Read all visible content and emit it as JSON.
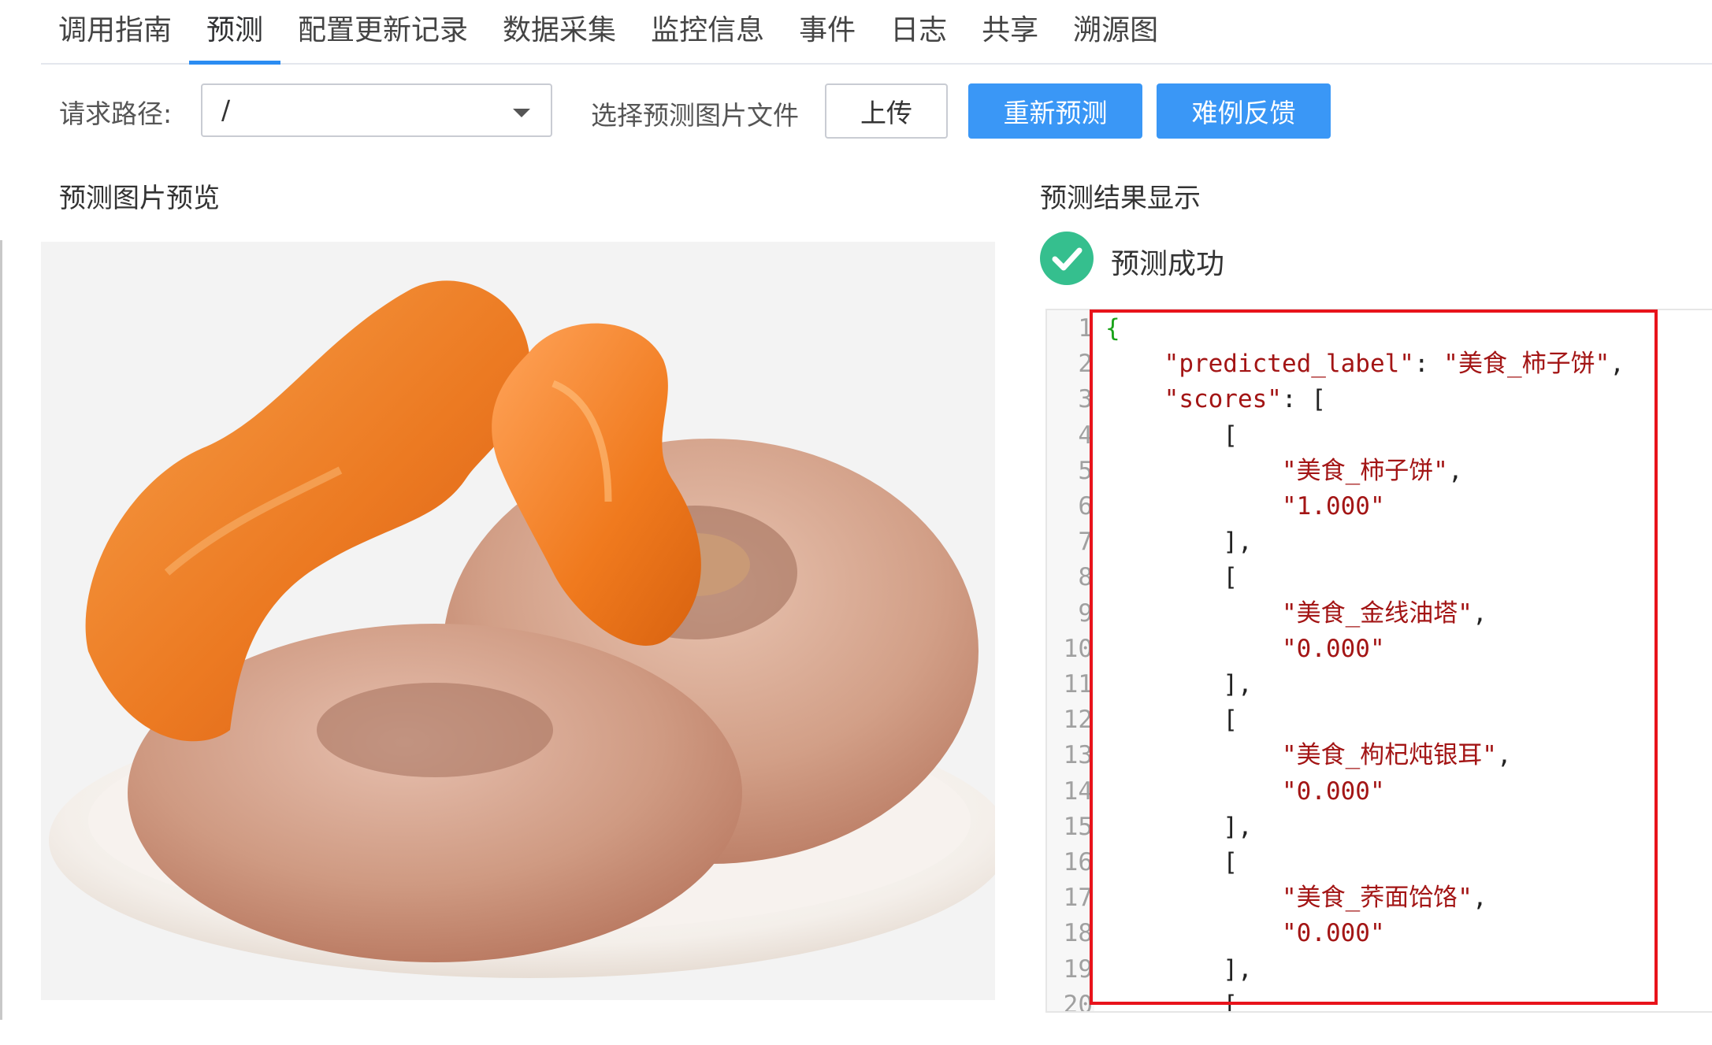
{
  "tabs": [
    {
      "label": "调用指南",
      "active": false
    },
    {
      "label": "预测",
      "active": true
    },
    {
      "label": "配置更新记录",
      "active": false
    },
    {
      "label": "数据采集",
      "active": false
    },
    {
      "label": "监控信息",
      "active": false
    },
    {
      "label": "事件",
      "active": false
    },
    {
      "label": "日志",
      "active": false
    },
    {
      "label": "共享",
      "active": false
    },
    {
      "label": "溯源图",
      "active": false
    }
  ],
  "toolbar": {
    "path_label": "请求路径:",
    "path_value": "/",
    "file_label": "选择预测图片文件",
    "upload_label": "上传",
    "repredict_label": "重新预测",
    "feedback_label": "难例反馈"
  },
  "preview": {
    "heading": "预测图片预览",
    "image_subject": "dried persimmons (柿子饼) on a white plate"
  },
  "result": {
    "heading": "预测结果显示",
    "status_text": "预测成功",
    "status_color": "#35bf8e"
  },
  "code_lines": [
    {
      "n": "1",
      "text": "{"
    },
    {
      "n": "2",
      "text": "    \"predicted_label\": \"美食_柿子饼\","
    },
    {
      "n": "3",
      "text": "    \"scores\": ["
    },
    {
      "n": "4",
      "text": "        ["
    },
    {
      "n": "5",
      "text": "            \"美食_柿子饼\","
    },
    {
      "n": "6",
      "text": "            \"1.000\""
    },
    {
      "n": "7",
      "text": "        ],"
    },
    {
      "n": "8",
      "text": "        ["
    },
    {
      "n": "9",
      "text": "            \"美食_金线油塔\","
    },
    {
      "n": "10",
      "text": "            \"0.000\""
    },
    {
      "n": "11",
      "text": "        ],"
    },
    {
      "n": "12",
      "text": "        ["
    },
    {
      "n": "13",
      "text": "            \"美食_枸杞炖银耳\","
    },
    {
      "n": "14",
      "text": "            \"0.000\""
    },
    {
      "n": "15",
      "text": "        ],"
    },
    {
      "n": "16",
      "text": "        ["
    },
    {
      "n": "17",
      "text": "            \"美食_荞面饸饹\","
    },
    {
      "n": "18",
      "text": "            \"0.000\""
    },
    {
      "n": "19",
      "text": "        ],"
    },
    {
      "n": "20",
      "text": "        ["
    }
  ],
  "colors": {
    "accent": "#3a97f6",
    "tab_underline": "#2b8cf2",
    "highlight_box": "#e8131b",
    "json_string": "#a31515",
    "json_brace": "#1aa31a"
  }
}
